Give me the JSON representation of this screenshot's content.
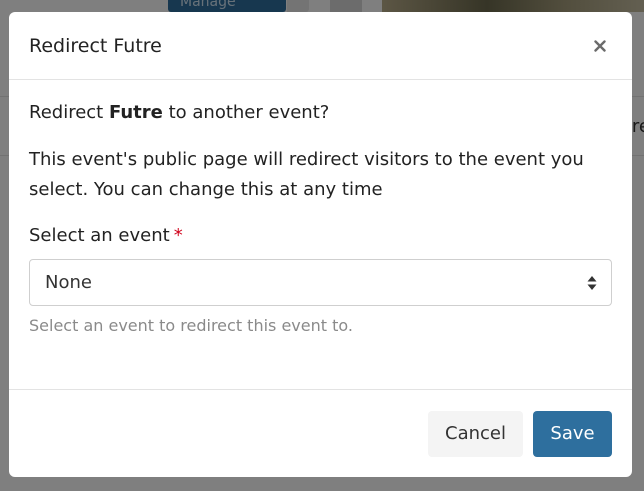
{
  "background": {
    "manage_label": "Manage",
    "row_text_fragment": "re"
  },
  "modal": {
    "title": "Redirect Futre",
    "question": {
      "prefix": "Redirect ",
      "event_name": "Futre",
      "suffix": " to another event?"
    },
    "description": "This event's public page will redirect visitors to the event you select. You can change this at any time",
    "field": {
      "label": "Select an event",
      "required_mark": "*",
      "selected_value": "None",
      "help_text": "Select an event to redirect this event to."
    },
    "footer": {
      "cancel_label": "Cancel",
      "save_label": "Save"
    }
  },
  "colors": {
    "primary": "#2e6f9e",
    "required": "#d0021b",
    "overlay": "rgba(0,0,0,0.5)"
  },
  "icons": {
    "close": "close-icon",
    "select_arrows": "sort-arrows-icon"
  }
}
